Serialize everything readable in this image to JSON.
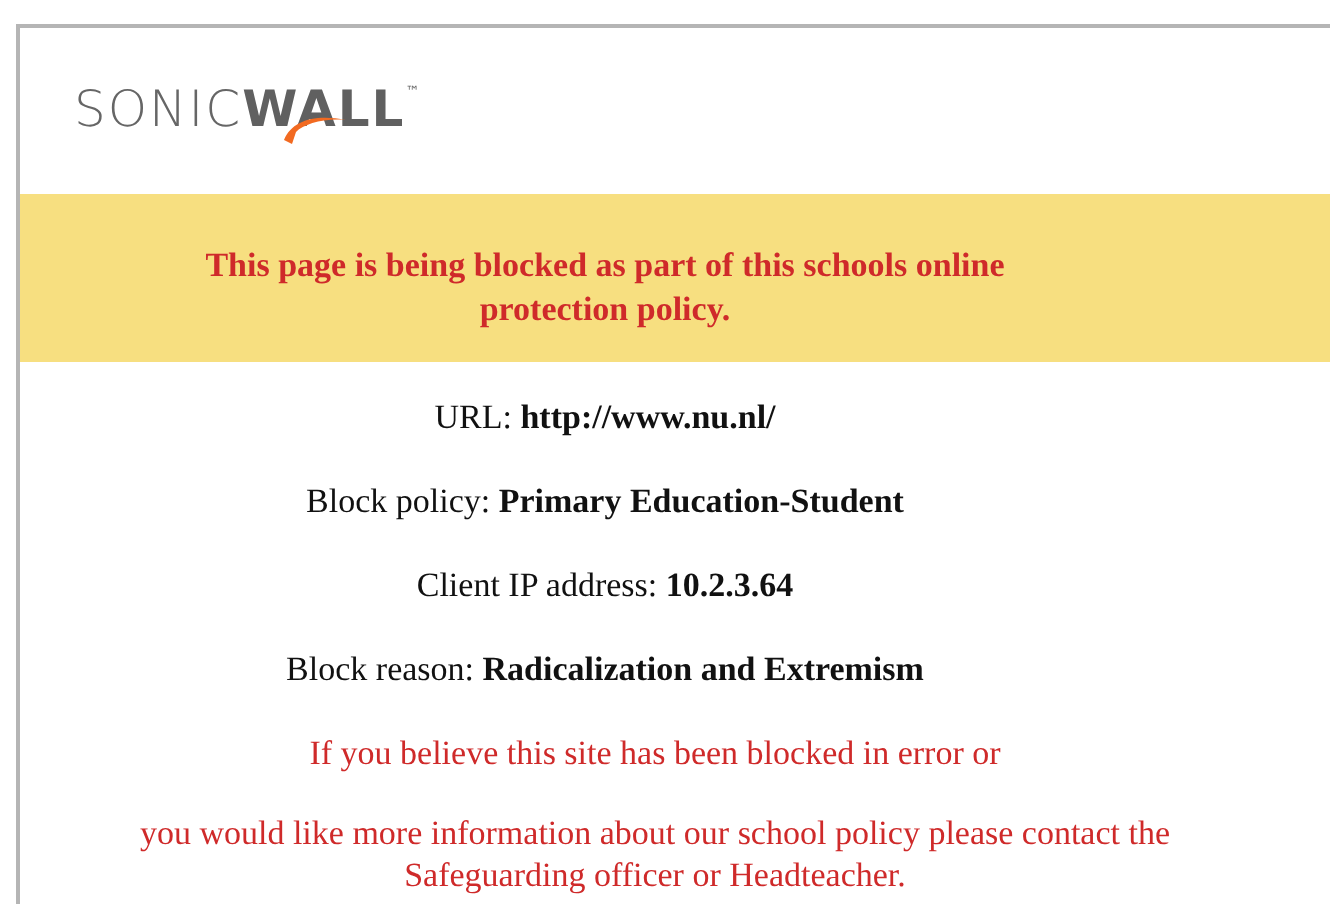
{
  "logo": {
    "light": "SONIC",
    "bold": "WALL",
    "mark": "™"
  },
  "banner": {
    "message": "This page is being blocked as part of this schools online protection policy."
  },
  "details": [
    "URL: **http://www.nu.nl/**",
    "Block policy: **Primary Education-Student**",
    "Client IP address: **10.2.3.64**",
    "Block reason: **Radicalization and Extremism**"
  ],
  "notice": [
    "If you believe this site has been blocked in error or",
    "you would like more information about our school policy please contact the Safeguarding officer or Headteacher."
  ]
}
